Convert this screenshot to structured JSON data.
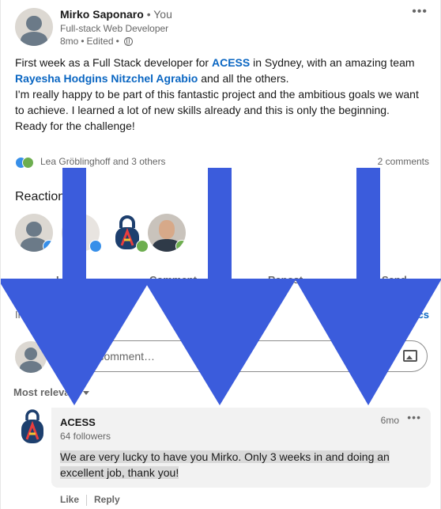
{
  "post": {
    "author": {
      "name": "Mirko Saponaro",
      "you": "• You",
      "headline": "Full-stack Web Developer",
      "time": "8mo",
      "edited": "Edited"
    },
    "text": {
      "line1a": "First week as a Full Stack developer for ",
      "mention1": "ACESS",
      "line1b": " in Sydney, with an amazing team ",
      "mention2": "Rayesha Hodgins Nitzchel Agrabio",
      "line1c": " and all the others.",
      "line2": "I'm really happy to be part of this fantastic project and the ambitious goals we want to achieve. I learned a lot of new skills already and this is only the beginning.",
      "line3": "Ready for the challenge!"
    },
    "social": {
      "reactors": "Lea Gröblinghoff and 3 others",
      "comments": "2 comments"
    },
    "reactions_title": "Reactions",
    "actions": {
      "like": "Like",
      "comment": "Comment",
      "repost": "Repost",
      "send": "Send"
    },
    "analytics": {
      "left": "Impressions",
      "right": "View analytics"
    },
    "comment_placeholder": "Add a comment…",
    "sort": "Most relevant"
  },
  "comment": {
    "author": "ACESS",
    "followers": "64 followers",
    "time": "6mo",
    "text": "We are very lucky to have you Mirko. Only 3 weeks in and doing an excellent job, thank you!",
    "like": "Like",
    "reply": "Reply"
  },
  "colors": {
    "link": "#0a66c2",
    "arrow": "#3b5cdc",
    "like": "#378fe9",
    "support": "#6dae4f"
  }
}
